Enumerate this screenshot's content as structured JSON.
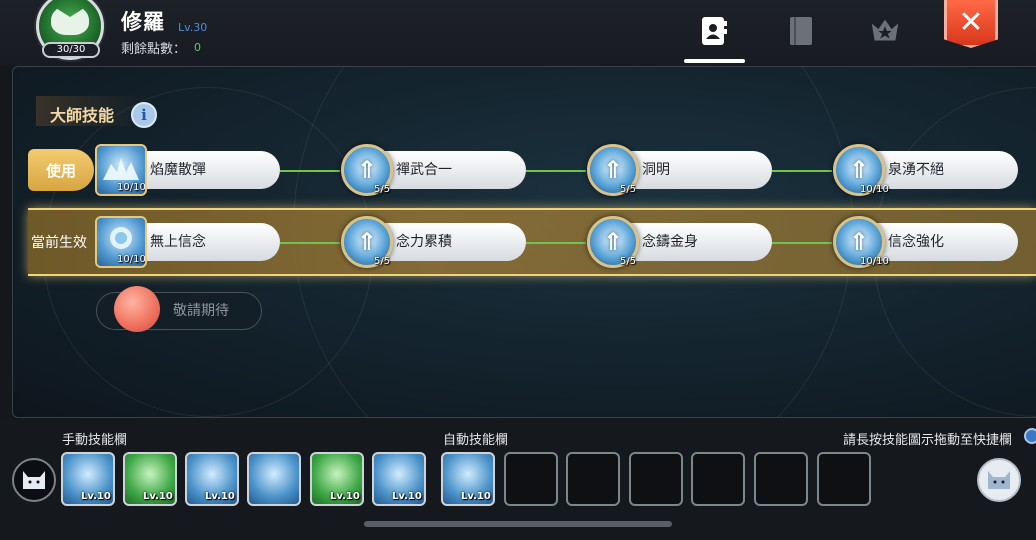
{
  "header": {
    "avatar_badge": "30/30",
    "char_name": "修羅",
    "char_level": "Lv.30",
    "points_label": "剩餘點數：",
    "points_value": "0",
    "tabs": [
      "profile-tab-icon",
      "book-tab-icon",
      "rank-star-icon"
    ],
    "close_label": "✕"
  },
  "section": {
    "title": "大師技能",
    "info_glyph": "i"
  },
  "rows": [
    {
      "side_label": "使用",
      "skills": [
        {
          "name": "焰魔散彈",
          "level": "10/10"
        },
        {
          "name": "禪武合一",
          "level": "5/5"
        },
        {
          "name": "洞明",
          "level": "5/5"
        },
        {
          "name": "泉湧不絕",
          "level": "10/10"
        }
      ]
    },
    {
      "side_label": "當前生效",
      "skills": [
        {
          "name": "無上信念",
          "level": "10/10"
        },
        {
          "name": "念力累積",
          "level": "5/5"
        },
        {
          "name": "念鑄金身",
          "level": "5/5"
        },
        {
          "name": "信念強化",
          "level": "10/10"
        }
      ]
    }
  ],
  "coming_soon": "敬請期待",
  "bottom": {
    "manual_label": "手動技能欄",
    "auto_label": "自動技能欄",
    "hint": "請長按技能圖示拖動至快捷欄",
    "manual_slots": [
      "Lv.10",
      "Lv.10",
      "Lv.10",
      "",
      "Lv.10",
      "Lv.10"
    ],
    "auto_slots": [
      "Lv.10",
      "",
      "",
      "",
      "",
      "",
      ""
    ]
  },
  "colors": {
    "accent_gold": "#f1d27a",
    "level_blue": "#4a8ee0",
    "points_green": "#5ecb5e",
    "close_red": "#e8482a"
  }
}
